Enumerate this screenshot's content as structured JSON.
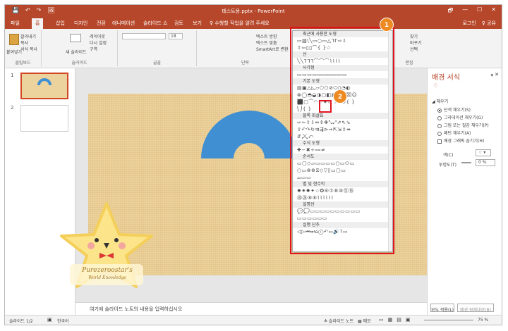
{
  "window": {
    "title": "테스트용.pptx - PowerPoint",
    "qat": [
      "💾",
      "↶",
      "↷",
      "🖼"
    ],
    "controls": [
      "🗗",
      "—",
      "☐",
      "✕"
    ]
  },
  "tabs": [
    "파일",
    "홈",
    "삽입",
    "디자인",
    "전환",
    "애니메이션",
    "슬라이드 쇼",
    "검토",
    "보기",
    "♀ 수행할 작업을 알려 주세요"
  ],
  "account": {
    "login": "로그인",
    "share": "♀ 공유"
  },
  "ribbon": {
    "clipboard": {
      "label": "클립보드",
      "paste": "붙여넣기",
      "cut": "잘라내기",
      "copy": "복사",
      "format": "서식 복사"
    },
    "slides": {
      "label": "슬라이드",
      "new": "새 슬라이드",
      "layout": "레이아웃",
      "reset": "다시 설정",
      "section": "구역"
    },
    "font": {
      "label": "글꼴",
      "size": "18"
    },
    "paragraph": {
      "label": "단락",
      "textdir": "텍스트 방향",
      "align": "텍스트 맞춤",
      "smartart": "SmartArt로 변환"
    },
    "editing": {
      "label": "편집",
      "find": "찾기",
      "replace": "바꾸기",
      "select": "선택"
    }
  },
  "shapes_gallery": {
    "sections": [
      {
        "title": "최근에 사용한 도형",
        "rows": [
          "▭▧\\╲▭○▭△ᒣᒥ⇨⇩",
          "⇧⇦▯▯⌒{ }☆"
        ]
      },
      {
        "title": "선",
        "rows": [
          "╲╲ᒣᒣᒣ⌒⌒⌒⌇⌇⌇⌇"
        ]
      },
      {
        "title": "사각형",
        "rows": [
          "▭▭▭▭▭▭▭▭▭▭"
        ]
      },
      {
        "title": "기본 도형",
        "rows": [
          "▤▣△◺▱⬠⬡⊘⬭⬯◔◐",
          "⊗◯◓◒◑▢◧▣⬚⌓⌧☺",
          "⬛▢⏜◠♡✷☾☽⊂⊃{ }",
          "⎝⎠{ }"
        ]
      },
      {
        "title": "블록 화살표",
        "rows": [
          "⇨⇦⇧⇩⇔⇕✥⤡⤢⇗⇖⇘",
          "⇪↶↷↻⇉⇶⊳⇝⇱⇲⇳⇴",
          "⇵⤸⤹⤺"
        ]
      },
      {
        "title": "수식 도형",
        "rows": [
          "✚−✖÷⩵≠"
        ]
      },
      {
        "title": "순서도",
        "rows": [
          "▭▢◇▱▭▭▭▭○▭⬭▭",
          "○▭⊗⊕⧖◇▽▯▭▢▭",
          "⌓▭▭"
        ]
      },
      {
        "title": "별 및 현수막",
        "rows": [
          "✸✷✹✦☆✪⑥⑦⑧⑩⑫⑯",
          "⑳㉔⑧⑧⌇⌇⌇⌇⌇⌇"
        ]
      },
      {
        "title": "설명선",
        "rows": [
          "💬💭▭▭▭▭▭▭▭▭▭▭",
          "▭▭▭▭▭▭"
        ]
      },
      {
        "title": "실행 단추",
        "rows": [
          "◁▷⏮⏭⌂ⓘ↶▭🔊?▭"
        ]
      }
    ]
  },
  "slides": [
    {
      "num": "1"
    },
    {
      "num": "2"
    }
  ],
  "format_pane": {
    "title": "배경 서식",
    "section": "채우기",
    "options": [
      "단색 채우기(S)",
      "그라데이션 채우기(G)",
      "그림 또는 질감 채우기(P)",
      "패턴 채우기(A)"
    ],
    "checkbox": "배경 그래픽 숨기기(H)",
    "color_label": "색(C)",
    "transparency_label": "투명도(T)",
    "transparency_value": "0 %",
    "apply_all": "모두 적용(L)",
    "reset": "배경 원래대로(B)"
  },
  "notes": "여기에 슬라이드 노트의 내용을 입력하십시오",
  "status": {
    "slide": "슬라이드 1/2",
    "lang": "한국어",
    "notes": "≜ 슬라이드 노트",
    "comments": "▦ 메모",
    "zoom": "75 %"
  },
  "badges": [
    "1",
    "2"
  ],
  "watermark": {
    "line1": "Purezeroostar's",
    "line2": "World Knowledge"
  },
  "colors": {
    "accent": "#b7472a",
    "arc": "#3f8fd2",
    "highlight": "#e0141e",
    "badge": "#ee8a22"
  }
}
